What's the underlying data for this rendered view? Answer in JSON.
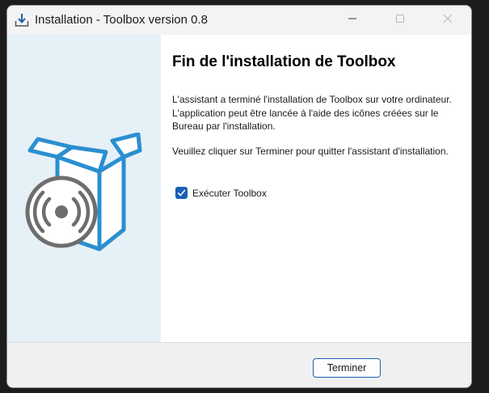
{
  "window": {
    "title": "Installation - Toolbox version 0.8",
    "icon": "download-installer-icon",
    "controls": {
      "minimize": "minimize-icon",
      "maximize": "maximize-icon",
      "close": "close-icon"
    }
  },
  "sidebar": {
    "image": "software-box-with-disc-illustration",
    "colors": {
      "background": "#e6f0f7",
      "box_outline": "#2a8fd0",
      "disc": "#6e6e6e"
    }
  },
  "content": {
    "heading": "Fin de l'installation de Toolbox",
    "paragraph1": "L'assistant a terminé l'installation de Toolbox sur votre ordinateur. L'application peut être lancée à l'aide des icônes créées sur le Bureau par l'installation.",
    "paragraph2": "Veuillez cliquer sur Terminer pour quitter l'assistant d'installation.",
    "checkbox": {
      "label": "Exécuter Toolbox",
      "checked": true
    }
  },
  "footer": {
    "finish_label": "Terminer"
  },
  "colors": {
    "accent": "#1a5fb4",
    "titlebar": "#f3f3f3",
    "footer": "#f0f0f0"
  }
}
